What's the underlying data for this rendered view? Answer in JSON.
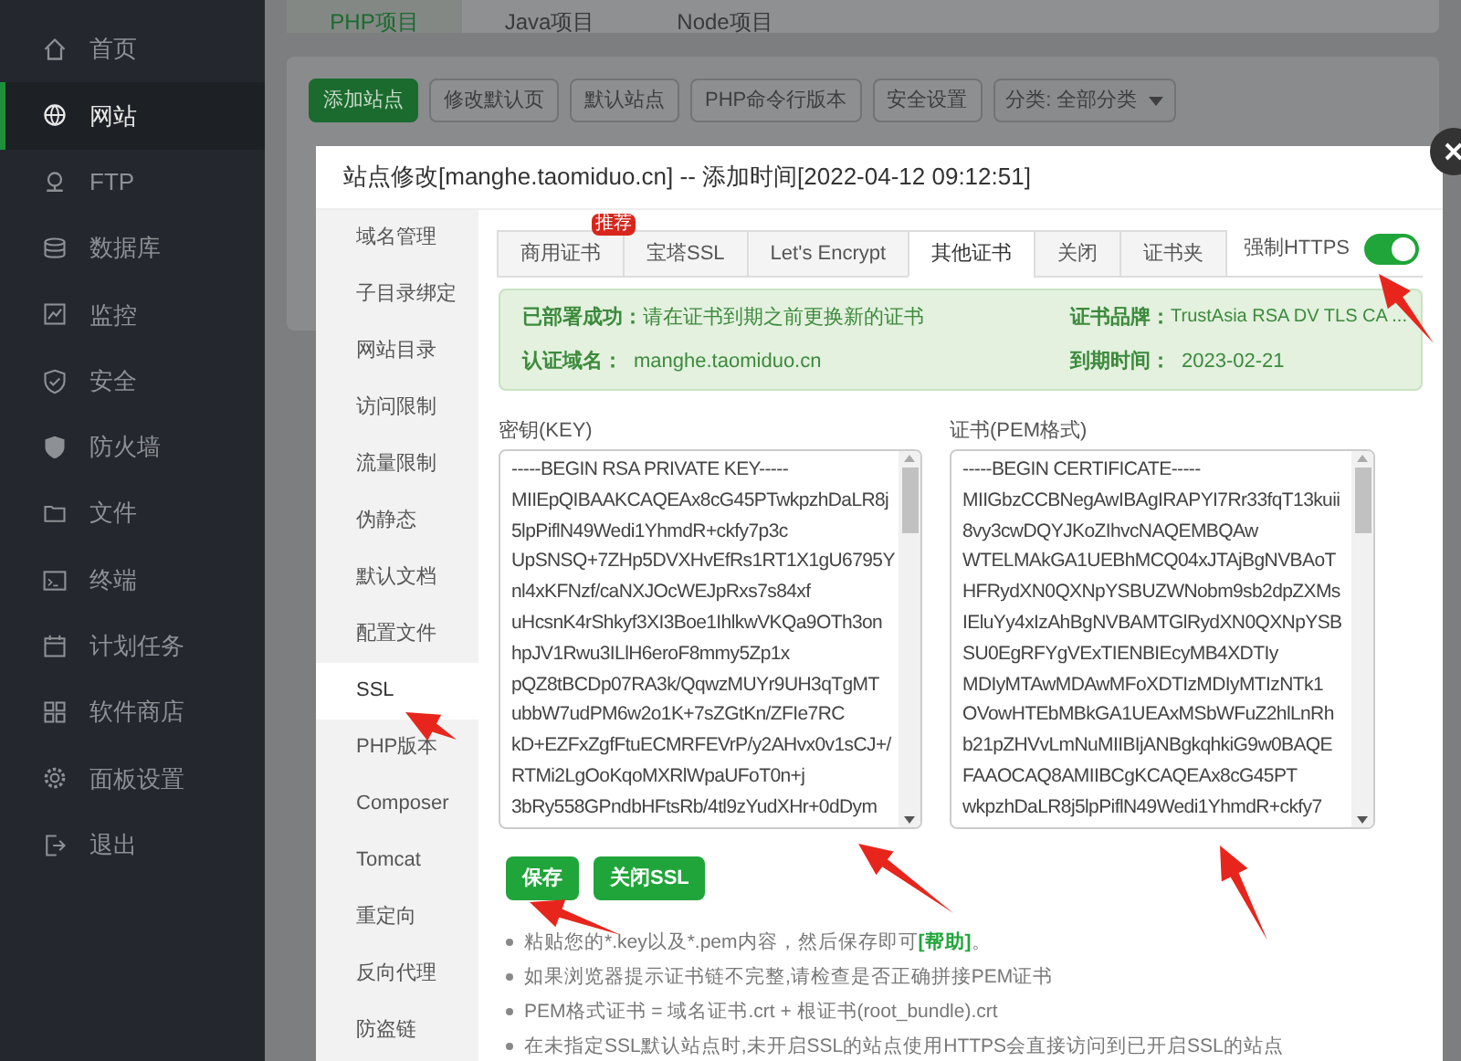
{
  "sidebar": {
    "items": [
      {
        "label": "首页",
        "selected": false
      },
      {
        "label": "网站",
        "selected": true
      },
      {
        "label": "FTP",
        "selected": false
      },
      {
        "label": "数据库",
        "selected": false
      },
      {
        "label": "监控",
        "selected": false
      },
      {
        "label": "安全",
        "selected": false
      },
      {
        "label": "防火墙",
        "selected": false
      },
      {
        "label": "文件",
        "selected": false
      },
      {
        "label": "终端",
        "selected": false
      },
      {
        "label": "计划任务",
        "selected": false
      },
      {
        "label": "软件商店",
        "selected": false
      },
      {
        "label": "面板设置",
        "selected": false
      },
      {
        "label": "退出",
        "selected": false
      }
    ]
  },
  "project_tabs": [
    {
      "label": "PHP项目",
      "selected": true
    },
    {
      "label": "Java项目",
      "selected": false
    },
    {
      "label": "Node项目",
      "selected": false
    }
  ],
  "toolbar": {
    "buttons": [
      {
        "label": "添加站点",
        "kind": "primary"
      },
      {
        "label": "修改默认页",
        "kind": "default"
      },
      {
        "label": "默认站点",
        "kind": "default"
      },
      {
        "label": "PHP命令行版本",
        "kind": "default"
      },
      {
        "label": "安全设置",
        "kind": "default"
      }
    ],
    "category": {
      "value": "分类: 全部分类"
    }
  },
  "dialog": {
    "title": "站点修改[manghe.taomiduo.cn] -- 添加时间[2022-04-12 09:12:51]",
    "menu": [
      {
        "label": "域名管理",
        "selected": false
      },
      {
        "label": "子目录绑定",
        "selected": false
      },
      {
        "label": "网站目录",
        "selected": false
      },
      {
        "label": "访问限制",
        "selected": false
      },
      {
        "label": "流量限制",
        "selected": false
      },
      {
        "label": "伪静态",
        "selected": false
      },
      {
        "label": "默认文档",
        "selected": false
      },
      {
        "label": "配置文件",
        "selected": false
      },
      {
        "label": "SSL",
        "selected": true
      },
      {
        "label": "PHP版本",
        "selected": false
      },
      {
        "label": "Composer",
        "selected": false
      },
      {
        "label": "Tomcat",
        "selected": false
      },
      {
        "label": "重定向",
        "selected": false
      },
      {
        "label": "反向代理",
        "selected": false
      },
      {
        "label": "防盗链",
        "selected": false
      }
    ],
    "ssl_tabs": [
      {
        "label": "商用证书",
        "selected": false,
        "badge": "推荐"
      },
      {
        "label": "宝塔SSL",
        "selected": false
      },
      {
        "label": "Let's Encrypt",
        "selected": false
      },
      {
        "label": "其他证书",
        "selected": true
      },
      {
        "label": "关闭",
        "selected": false
      },
      {
        "label": "证书夹",
        "selected": false
      }
    ],
    "force_https": {
      "label": "强制HTTPS",
      "on": true
    },
    "status": {
      "deployed_label": "已部署成功：",
      "deployed_text": "请在证书到期之前更换新的证书",
      "domain_label": "认证域名：",
      "domain": "manghe.taomiduo.cn",
      "brand_label": "证书品牌：",
      "brand": "TrustAsia RSA DV TLS CA ...",
      "expiry_label": "到期时间：",
      "expiry": "2023-02-21"
    },
    "key": {
      "label": "密钥(KEY)",
      "lines": [
        "-----BEGIN RSA PRIVATE KEY-----",
        "MIIEpQIBAAKCAQEAx8cG45PTwkpzhDaLR8j",
        "5lpPiflN49Wedi1YhmdR+ckfy7p3c",
        "UpSNSQ+7ZHp5DVXHvEfRs1RT1X1gU6795Y",
        "nl4xKFNzf/caNXJOcWEJpRxs7s84xf",
        "uHcsnK4rShkyf3XI3Boe1IhlkwVKQa9OTh3on",
        "hpJV1Rwu3ILlH6eroF8mmy5Zp1x",
        "pQZ8tBCDp07RA3k/QqwzMUYr9UH3qTgMT",
        "ubbW7udPM6w2o1K+7sZGtKn/ZFIe7RC",
        "kD+EZFxZgfFtuECMRFEVrP/y2AHvx0v1sCJ+/",
        "RTMi2LgOoKqoMXRlWpaUFoT0n+j",
        "3bRy558GPndbHFtsRb/4tl9zYudXHr+0dDym"
      ]
    },
    "certificate": {
      "label": "证书(PEM格式)",
      "lines": [
        "-----BEGIN CERTIFICATE-----",
        "MIIGbzCCBNegAwIBAgIRAPYI7Rr33fqT13kuii",
        "8vy3cwDQYJKoZIhvcNAQEMBQAw",
        "WTELMAkGA1UEBhMCQ04xJTAjBgNVBAoT",
        "HFRydXN0QXNpYSBUZWNobm9sb2dpZXMs",
        "IEluYy4xIzAhBgNVBAMTGlRydXN0QXNpYSB",
        "SU0EgRFYgVExTIENBIEcyMB4XDTIy",
        "MDIyMTAwMDAwMFoXDTIzMDIyMTIzNTk1",
        "OVowHTEbMBkGA1UEAxMSbWFuZ2hlLnRh",
        "b21pZHVvLmNuMIIBIjANBgkqhkiG9w0BAQE",
        "FAAOCAQ8AMIIBCgKCAQEAx8cG45PT",
        "wkpzhDaLR8j5lpPiflN49Wedi1YhmdR+ckfy7"
      ]
    },
    "buttons": [
      "保存",
      "关闭SSL"
    ],
    "tips": [
      {
        "text": "粘贴您的*.key以及*.pem内容，然后保存即可",
        "link": "[帮助]",
        "after": "。"
      },
      {
        "text": "如果浏览器提示证书链不完整,请检查是否正确拼接PEM证书"
      },
      {
        "text": "PEM格式证书 = 域名证书.crt + 根证书(root_bundle).crt"
      },
      {
        "text": "在未指定SSL默认站点时,未开启SSL的站点使用HTTPS会直接访问到已开启SSL的站点"
      }
    ]
  }
}
